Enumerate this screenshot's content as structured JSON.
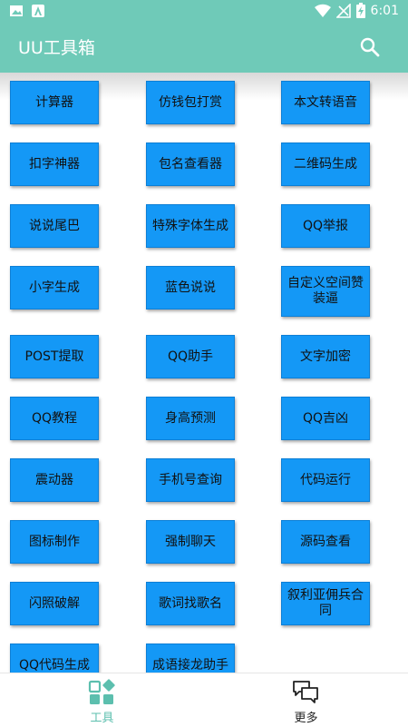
{
  "status_bar": {
    "time": "6:01",
    "left_icons": [
      "image-icon",
      "app-notification-icon"
    ],
    "right_icons": [
      "wifi-icon",
      "no-signal-icon",
      "battery-charging-icon"
    ]
  },
  "app_bar": {
    "title": "UU工具箱",
    "search_icon": "search-icon"
  },
  "tools": [
    {
      "label": "计算器"
    },
    {
      "label": "仿钱包打赏"
    },
    {
      "label": "本文转语音"
    },
    {
      "label": "扣字神器"
    },
    {
      "label": "包名查看器"
    },
    {
      "label": "二维码生成"
    },
    {
      "label": "说说尾巴"
    },
    {
      "label": "特殊字体生成"
    },
    {
      "label": "QQ举报"
    },
    {
      "label": "小字生成"
    },
    {
      "label": "蓝色说说"
    },
    {
      "label": "自定义空间赞装逼"
    },
    {
      "label": "POST提取"
    },
    {
      "label": "QQ助手"
    },
    {
      "label": "文字加密"
    },
    {
      "label": "QQ教程"
    },
    {
      "label": "身高预测"
    },
    {
      "label": "QQ吉凶"
    },
    {
      "label": "震动器"
    },
    {
      "label": "手机号查询"
    },
    {
      "label": "代码运行"
    },
    {
      "label": "图标制作"
    },
    {
      "label": "强制聊天"
    },
    {
      "label": "源码查看"
    },
    {
      "label": "闪照破解"
    },
    {
      "label": "歌词找歌名"
    },
    {
      "label": "叙利亚佣兵合同"
    },
    {
      "label": "QQ代码生成"
    },
    {
      "label": "成语接龙助手"
    }
  ],
  "bottom_nav": [
    {
      "label": "工具",
      "icon": "tools-grid-icon",
      "active": true
    },
    {
      "label": "更多",
      "icon": "chat-bubbles-icon",
      "active": false
    }
  ],
  "colors": {
    "primary": "#6fcab8",
    "tool_button": "#1498f6",
    "nav_active": "#5cbfae",
    "nav_inactive": "#222222"
  }
}
